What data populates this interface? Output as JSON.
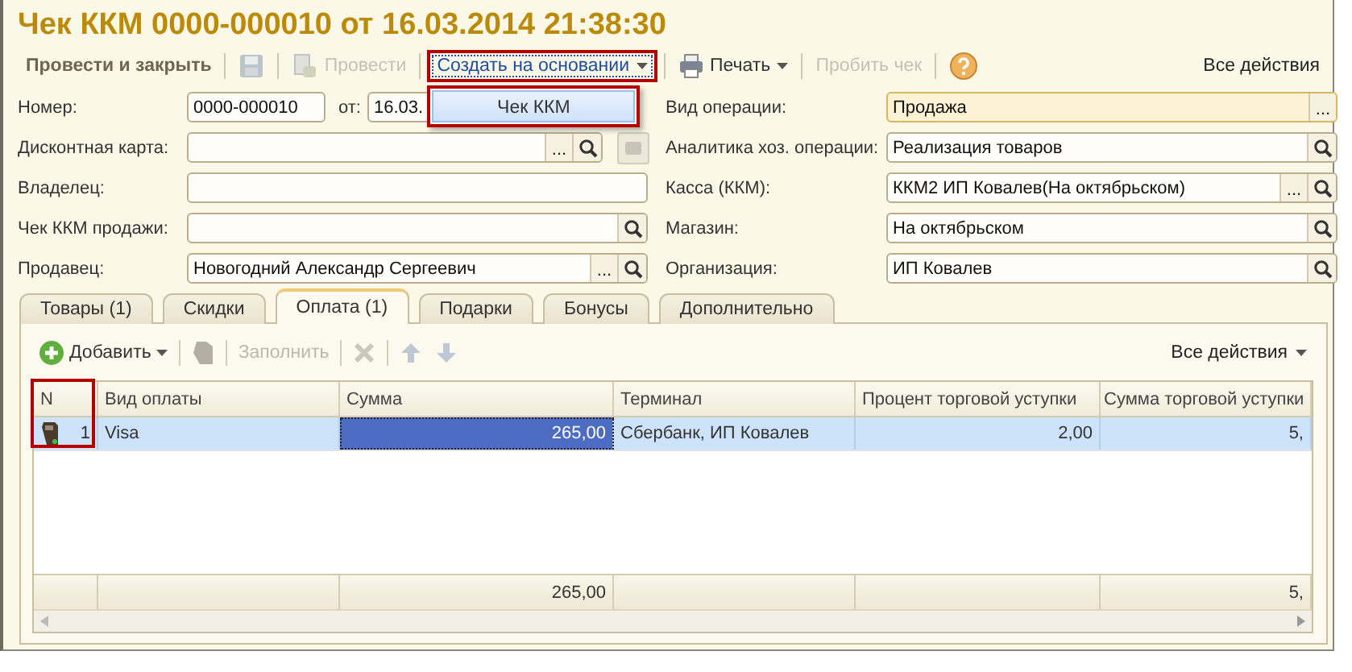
{
  "window": {
    "title": "Чек ККМ 0000-000010 от 16.03.2014 21:38:30"
  },
  "toolbar": {
    "items": [
      {
        "kind": "primary",
        "label": "Провести и закрыть",
        "disabled": false,
        "open": false
      },
      {
        "kind": "save",
        "disabled": true,
        "open": false
      },
      {
        "kind": "post",
        "label": "Провести",
        "disabled": true,
        "open": false
      },
      {
        "kind": "menu",
        "label": "Создать на основании",
        "disabled": false,
        "open": true
      },
      {
        "kind": "print",
        "label": "Печать",
        "disabled": false,
        "open": false
      },
      {
        "kind": "plain",
        "label": "Пробить чек",
        "disabled": true,
        "open": false
      },
      {
        "kind": "help",
        "disabled": false,
        "open": false
      }
    ],
    "all_actions": "Все действия",
    "dropdown": {
      "items": [
        "Чек ККМ"
      ]
    }
  },
  "form": {
    "left": [
      {
        "kind": "number_date",
        "label": "Номер:",
        "value": "0000-000010",
        "date_label": "от:",
        "date_value": "16.03.",
        "focused": false,
        "search": false,
        "extra_button": false
      },
      {
        "kind": "field",
        "label": "Дисконтная карта:",
        "focused": false,
        "choice_button": "...",
        "search": true,
        "extra_button": true
      },
      {
        "kind": "field",
        "label": "Владелец:",
        "focused": false,
        "search": false,
        "extra_button": false
      },
      {
        "kind": "field",
        "label": "Чек ККМ продажи:",
        "focused": false,
        "search": true,
        "extra_button": false
      },
      {
        "kind": "field",
        "label": "Продавец:",
        "value": "Новогодний Александр Сергеевич",
        "focused": false,
        "choice_button": "...",
        "search": true,
        "extra_button": false
      }
    ],
    "right": [
      {
        "kind": "field",
        "label": "Вид операции:",
        "value": "Продажа",
        "focused": true,
        "choice_button": "...",
        "search": false,
        "extra_button": false
      },
      {
        "kind": "field",
        "label": "Аналитика хоз. операции:",
        "value": "Реализация товаров",
        "focused": false,
        "search": true,
        "extra_button": false
      },
      {
        "kind": "field",
        "label": "Касса (ККМ):",
        "value": "ККМ2 ИП Ковалев(На октябрьском)",
        "focused": false,
        "choice_button": "...",
        "search": true,
        "extra_button": false
      },
      {
        "kind": "field",
        "label": "Магазин:",
        "value": "На октябрьском",
        "focused": false,
        "search": true,
        "extra_button": false
      },
      {
        "kind": "field",
        "label": "Организация:",
        "value": "ИП Ковалев",
        "focused": false,
        "search": true,
        "extra_button": false
      }
    ]
  },
  "tabs": [
    {
      "label": "Товары (1)",
      "selected": false
    },
    {
      "label": "Скидки",
      "selected": false
    },
    {
      "label": "Оплата (1)",
      "selected": true
    },
    {
      "label": "Подарки",
      "selected": false
    },
    {
      "label": "Бонусы",
      "selected": false
    },
    {
      "label": "Дополнительно",
      "selected": false
    }
  ],
  "table_toolbar": {
    "items": [
      {
        "kind": "add",
        "label": "Добавить",
        "disabled": false
      },
      {
        "kind": "card",
        "disabled": true
      },
      {
        "kind": "plain",
        "label": "Заполнить",
        "disabled": true
      },
      {
        "kind": "delete",
        "disabled": true
      },
      {
        "kind": "up",
        "disabled": true
      },
      {
        "kind": "down",
        "disabled": true
      }
    ],
    "all_actions": "Все действия"
  },
  "table": {
    "columns": [
      {
        "title": "N",
        "kind": "number"
      },
      {
        "title": "Вид оплаты",
        "kind": "text"
      },
      {
        "title": "Сумма",
        "kind": "number",
        "total": "265,00"
      },
      {
        "title": "Терминал",
        "kind": "text"
      },
      {
        "title": "Процент торговой уступки",
        "kind": "number"
      },
      {
        "title": "Сумма торговой уступки",
        "kind": "number",
        "total": "5,"
      }
    ],
    "rows": [
      {
        "selected": true,
        "cells": [
          {
            "text": "1",
            "focused": false
          },
          {
            "text": "Visa",
            "focused": false
          },
          {
            "text": "265,00",
            "focused": true
          },
          {
            "text": "Сбербанк, ИП Ковалев",
            "focused": false
          },
          {
            "text": "2,00",
            "focused": false
          },
          {
            "text": "5,",
            "focused": false
          }
        ]
      }
    ]
  }
}
